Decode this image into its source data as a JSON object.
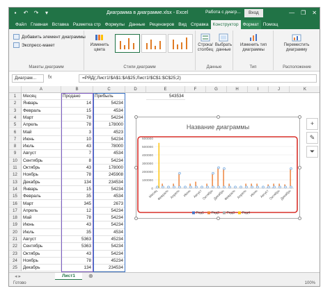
{
  "titlebar": {
    "doc_title": "Диаграмма в диаграмме.xlsx - Excel",
    "context_title": "Работа с диагр...",
    "login_button": "Вход",
    "minimize": "—",
    "restore": "❐",
    "close": "✕"
  },
  "tabs": [
    "Файл",
    "Главная",
    "Вставка",
    "Разметка стр",
    "Формулы",
    "Данные",
    "Рецензиров",
    "Вид",
    "Справка",
    "Конструктор",
    "Формат",
    "Помощ"
  ],
  "active_tab": "Конструктор",
  "ribbon": {
    "add_element": "Добавить элемент диаграммы",
    "quick_layout": "Экспресс-макет",
    "change_colors": [
      "Изменить",
      "цвета"
    ],
    "row_col": [
      "Строка/",
      "столбец"
    ],
    "select_data": [
      "Выбрать",
      "данные"
    ],
    "change_type": [
      "Изменить тип",
      "диаграммы"
    ],
    "move_chart": [
      "Переместить",
      "диаграмму"
    ],
    "group_layouts": "Макеты диаграмм",
    "group_styles": "Стили диаграмм",
    "group_data": "Данные",
    "group_type": "Тип",
    "group_location": "Расположение"
  },
  "formula_bar": {
    "name_box": "Диаграм...",
    "fx_label": "fx",
    "formula": "=РЯД(;Лист1!$A$1:$A$25;Лист1!$C$1:$C$25;2)"
  },
  "columns": [
    "A",
    "B",
    "C",
    "D",
    "E",
    "F",
    "G",
    "H",
    "I",
    "J",
    "K"
  ],
  "extra_cell_e1": "543534",
  "rows": [
    [
      "Месяц",
      "Продано",
      "Прибыль"
    ],
    [
      "Январь",
      "14",
      "54234"
    ],
    [
      "Февраль",
      "15",
      "4534"
    ],
    [
      "Март",
      "78",
      "54234"
    ],
    [
      "Апрель",
      "78",
      "178000"
    ],
    [
      "Май",
      "3",
      "4523"
    ],
    [
      "Июнь",
      "10",
      "54234"
    ],
    [
      "Июль",
      "43",
      "78000"
    ],
    [
      "Август",
      "7",
      "4534"
    ],
    [
      "Сентябрь",
      "8",
      "54234"
    ],
    [
      "Октябрь",
      "43",
      "178000"
    ],
    [
      "Ноябрь",
      "78",
      "245908"
    ],
    [
      "Декабрь",
      "134",
      "234534"
    ],
    [
      "Январь",
      "15",
      "54234"
    ],
    [
      "Февраль",
      "35",
      "4534"
    ],
    [
      "Март",
      "345",
      "2673"
    ],
    [
      "Апрель",
      "12",
      "54234"
    ],
    [
      "Май",
      "78",
      "54234"
    ],
    [
      "Июнь",
      "43",
      "54234"
    ],
    [
      "Июль",
      "35",
      "4534"
    ],
    [
      "Август",
      "5363",
      "45234"
    ],
    [
      "Сентябрь",
      "5363",
      "54234"
    ],
    [
      "Октябрь",
      "43",
      "54234"
    ],
    [
      "Ноябрь",
      "78",
      "45234"
    ],
    [
      "Декабрь",
      "134",
      "234534"
    ]
  ],
  "chart": {
    "title": "Название диаграммы"
  },
  "chart_data": {
    "type": "bar",
    "title": "Название диаграммы",
    "categories": [
      "Месяц",
      "Февраль",
      "Апрель",
      "Июнь",
      "Август",
      "Октябрь",
      "Декабрь",
      "Февраль",
      "Апрель",
      "Июнь",
      "Август",
      "Октябрь",
      "Декабрь"
    ],
    "category_count": 25,
    "ylim": [
      0,
      600000
    ],
    "y_ticks": [
      "600000",
      "500000",
      "400000",
      "300000",
      "200000",
      "100000",
      "0"
    ],
    "series": [
      {
        "name": "Ряд1",
        "color": "#4472c4",
        "values": [
          0,
          14,
          15,
          78,
          78,
          3,
          10,
          43,
          7,
          8,
          43,
          78,
          134,
          15,
          35,
          345,
          12,
          78,
          43,
          35,
          5363,
          5363,
          43,
          78,
          134
        ]
      },
      {
        "name": "Ряд2",
        "color": "#ed7d31",
        "values": [
          0,
          54234,
          4534,
          54234,
          178000,
          4523,
          54234,
          78000,
          4534,
          54234,
          178000,
          245908,
          234534,
          54234,
          4534,
          2673,
          54234,
          54234,
          54234,
          4534,
          45234,
          54234,
          54234,
          45234,
          234534
        ]
      },
      {
        "name": "Ряд3",
        "color": "#a5a5a5",
        "values": [
          0,
          0,
          0,
          0,
          0,
          0,
          0,
          0,
          0,
          0,
          0,
          0,
          0,
          0,
          0,
          0,
          0,
          0,
          0,
          0,
          0,
          0,
          0,
          0,
          0
        ]
      },
      {
        "name": "Ряд4",
        "color": "#ffc000",
        "values": [
          543534,
          0,
          0,
          0,
          0,
          0,
          0,
          0,
          0,
          0,
          0,
          0,
          0,
          0,
          0,
          0,
          0,
          0,
          0,
          0,
          0,
          0,
          0,
          0,
          0
        ]
      }
    ],
    "legend": [
      "Ряд1",
      "Ряд2",
      "Ряд3",
      "Ряд4"
    ],
    "legend_position": "bottom",
    "highlight_color": "#d9302a"
  },
  "sheet_tab": "Лист1",
  "add_sheet": "⊕",
  "status": "Готово",
  "zoom": "100%"
}
